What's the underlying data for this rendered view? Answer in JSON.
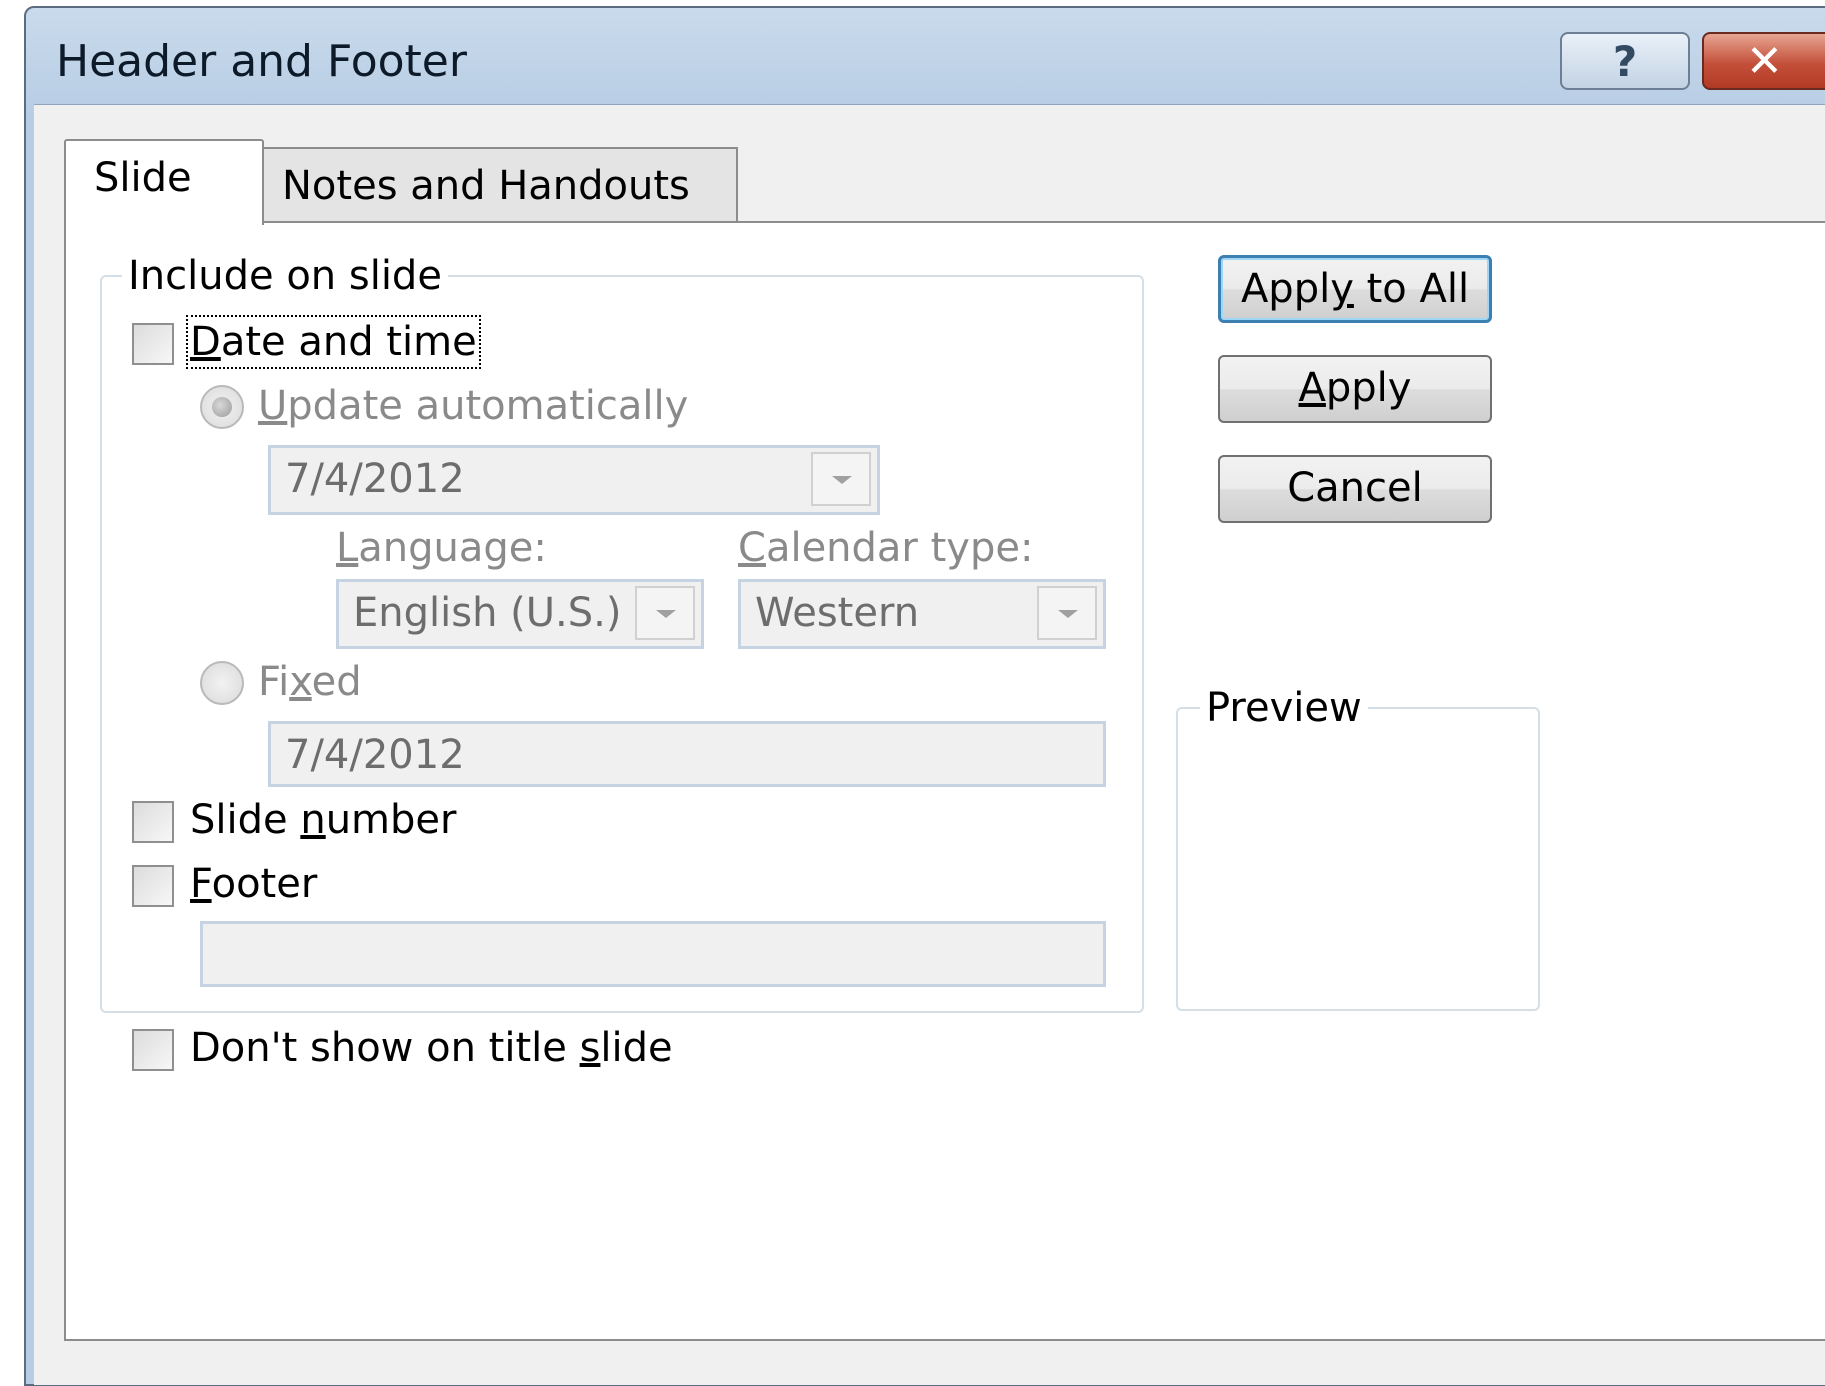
{
  "window": {
    "title": "Header and Footer",
    "help_label": "?",
    "close_label": "✕"
  },
  "tabs": [
    {
      "label": "Slide",
      "selected": true
    },
    {
      "label": "Notes and Handouts",
      "selected": false
    }
  ],
  "include_group": {
    "legend": "Include on slide",
    "date_and_time": {
      "label": "Date and time",
      "checked": false
    },
    "update_automatically": {
      "label_prefix": "",
      "accel": "U",
      "label_rest": "pdate automatically",
      "selected": true,
      "enabled": false
    },
    "auto_date_value": "7/4/2012",
    "language": {
      "accel": "L",
      "label_rest": "anguage:",
      "value": "English (U.S.)"
    },
    "calendar_type": {
      "accel": "C",
      "label_rest": "alendar type:",
      "value": "Western"
    },
    "fixed": {
      "label_prefix": "Fi",
      "accel": "x",
      "label_rest": "ed",
      "selected": false,
      "enabled": false
    },
    "fixed_date_value": "7/4/2012",
    "slide_number": {
      "label_prefix": "Slide ",
      "accel": "n",
      "label_rest": "umber",
      "checked": false
    },
    "footer": {
      "label_prefix": "",
      "accel": "F",
      "label_rest": "ooter",
      "checked": false
    },
    "footer_text_value": ""
  },
  "dont_show_title": {
    "label_prefix": "Don't show on title ",
    "accel": "s",
    "label_rest": "lide",
    "checked": false
  },
  "buttons": {
    "apply_all": {
      "prefix": "Appl",
      "accel": "y",
      "rest": " to All"
    },
    "apply": {
      "prefix": "",
      "accel": "A",
      "rest": "pply"
    },
    "cancel": "Cancel"
  },
  "preview": {
    "legend": "Preview"
  }
}
